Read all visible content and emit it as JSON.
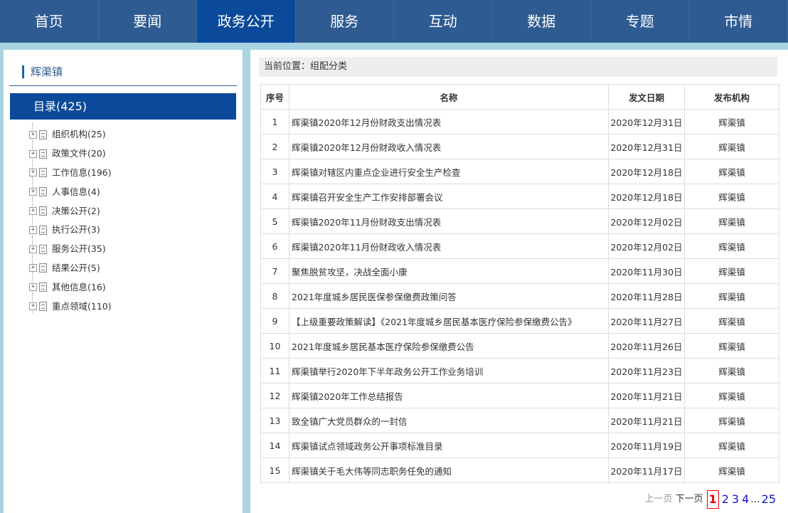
{
  "nav": [
    {
      "label": "首页"
    },
    {
      "label": "要闻"
    },
    {
      "label": "政务公开"
    },
    {
      "label": "服务"
    },
    {
      "label": "互动"
    },
    {
      "label": "数据"
    },
    {
      "label": "专题"
    },
    {
      "label": "市情"
    }
  ],
  "sidebar": {
    "title": "辉渠镇",
    "catalog": "目录(425)",
    "items": [
      {
        "label": "组织机构(25)"
      },
      {
        "label": "政策文件(20)"
      },
      {
        "label": "工作信息(196)"
      },
      {
        "label": "人事信息(4)"
      },
      {
        "label": "决策公开(2)"
      },
      {
        "label": "执行公开(3)"
      },
      {
        "label": "服务公开(35)"
      },
      {
        "label": "结果公开(5)"
      },
      {
        "label": "其他信息(16)"
      },
      {
        "label": "重点领域(110)"
      }
    ]
  },
  "main": {
    "breadcrumb": "当前位置：组配分类",
    "headers": {
      "no": "序号",
      "title": "名称",
      "date": "发文日期",
      "org": "发布机构"
    },
    "rows": [
      {
        "no": "1",
        "title": "辉渠镇2020年12月份财政支出情况表",
        "date": "2020年12月31日",
        "org": "辉渠镇"
      },
      {
        "no": "2",
        "title": "辉渠镇2020年12月份财政收入情况表",
        "date": "2020年12月31日",
        "org": "辉渠镇"
      },
      {
        "no": "3",
        "title": "辉渠镇对辖区内重点企业进行安全生产检查",
        "date": "2020年12月18日",
        "org": "辉渠镇"
      },
      {
        "no": "4",
        "title": "辉渠镇召开安全生产工作安排部署会议",
        "date": "2020年12月18日",
        "org": "辉渠镇"
      },
      {
        "no": "5",
        "title": "辉渠镇2020年11月份财政支出情况表",
        "date": "2020年12月02日",
        "org": "辉渠镇"
      },
      {
        "no": "6",
        "title": "辉渠镇2020年11月份财政收入情况表",
        "date": "2020年12月02日",
        "org": "辉渠镇"
      },
      {
        "no": "7",
        "title": "聚焦脱贫攻坚，决战全面小康",
        "date": "2020年11月30日",
        "org": "辉渠镇"
      },
      {
        "no": "8",
        "title": "2021年度城乡居民医保参保缴费政策问答",
        "date": "2020年11月28日",
        "org": "辉渠镇"
      },
      {
        "no": "9",
        "title": "【上级重要政策解读】《2021年度城乡居民基本医疗保险参保缴费公告》",
        "date": "2020年11月27日",
        "org": "辉渠镇"
      },
      {
        "no": "10",
        "title": "2021年度城乡居民基本医疗保险参保缴费公告",
        "date": "2020年11月26日",
        "org": "辉渠镇"
      },
      {
        "no": "11",
        "title": "辉渠镇举行2020年下半年政务公开工作业务培训",
        "date": "2020年11月23日",
        "org": "辉渠镇"
      },
      {
        "no": "12",
        "title": "辉渠镇2020年工作总结报告",
        "date": "2020年11月21日",
        "org": "辉渠镇"
      },
      {
        "no": "13",
        "title": "致全镇广大党员群众的一封信",
        "date": "2020年11月21日",
        "org": "辉渠镇"
      },
      {
        "no": "14",
        "title": "辉渠镇试点领域政务公开事项标准目录",
        "date": "2020年11月19日",
        "org": "辉渠镇"
      },
      {
        "no": "15",
        "title": "辉渠镇关于毛大伟等同志职务任免的通知",
        "date": "2020年11月17日",
        "org": "辉渠镇"
      }
    ]
  },
  "pager": {
    "prev": "上一页",
    "next": "下一页",
    "pages": [
      "1",
      "2",
      "3",
      "4"
    ],
    "ellipsis": "...",
    "last": "25",
    "current": "1"
  }
}
